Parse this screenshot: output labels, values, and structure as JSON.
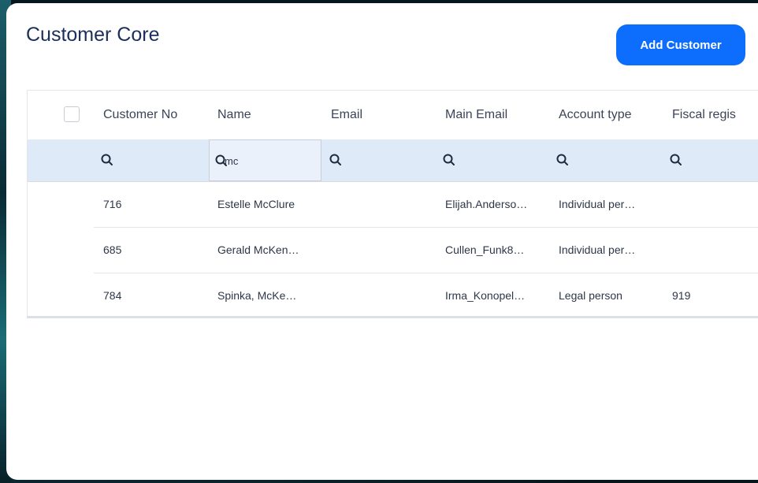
{
  "app": {
    "title": "Customer Core",
    "add_button_label": "Add Customer"
  },
  "colors": {
    "accent": "#0d6efd",
    "title": "#1b2f5c",
    "filter_row_bg": "#dfeaf8"
  },
  "table": {
    "columns": [
      "Customer No",
      "Name",
      "Email",
      "Main Email",
      "Account type",
      "Fiscal regis"
    ],
    "filters": {
      "name_value": "mc"
    },
    "rows": [
      {
        "customer_no": "716",
        "name": "Estelle McClure",
        "email": "",
        "main_email": "Elijah.Anderso…",
        "account_type": "Individual per…",
        "fiscal": ""
      },
      {
        "customer_no": "685",
        "name": "Gerald McKen…",
        "email": "",
        "main_email": "Cullen_Funk8…",
        "account_type": "Individual per…",
        "fiscal": ""
      },
      {
        "customer_no": "784",
        "name": "Spinka, McKe…",
        "email": "",
        "main_email": "Irma_Konopel…",
        "account_type": "Legal person",
        "fiscal": "919"
      }
    ]
  },
  "icons": {
    "filter": "search-icon"
  }
}
